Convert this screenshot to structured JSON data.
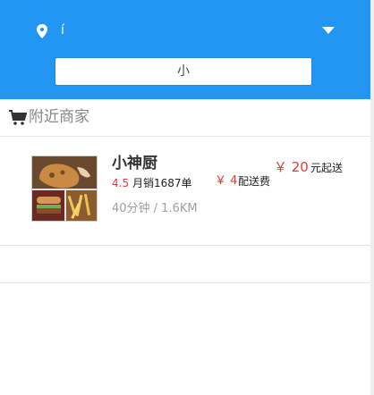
{
  "colors": {
    "header_bg": "#2196f3",
    "price_red": "#e53935",
    "muted_gray": "#9e9e9e"
  },
  "header": {
    "location_icon": "location-pin-icon",
    "location_text": "í",
    "dropdown_icon": "caret-down-icon",
    "search": {
      "value": "小"
    }
  },
  "section": {
    "icon": "cart-icon",
    "title": "附近商家"
  },
  "shops": [
    {
      "name": "小神厨",
      "rating": "4.5",
      "sales_text": "月销1687单",
      "min_order_symbol_amount": "￥ 20",
      "min_order_label": "元起送",
      "delivery_fee": "￥ 4",
      "delivery_fee_label": "配送费",
      "meta": "40分钟 / 1.6KM"
    }
  ]
}
